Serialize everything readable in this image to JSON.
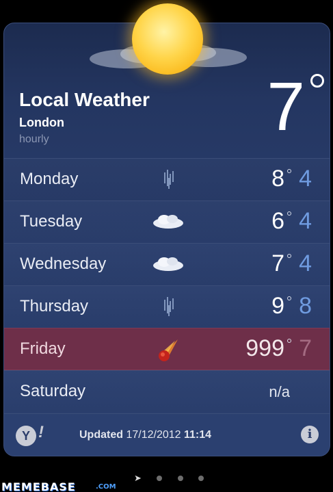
{
  "header": {
    "title": "Local Weather",
    "city": "London",
    "mode": "hourly",
    "current_temp": "7",
    "current_icon": "sun-with-clouds-icon"
  },
  "forecast": [
    {
      "day": "Monday",
      "icon": "rain-icon",
      "high": "8",
      "low": "4"
    },
    {
      "day": "Tuesday",
      "icon": "cloudy-icon",
      "high": "6",
      "low": "4"
    },
    {
      "day": "Wednesday",
      "icon": "cloudy-icon",
      "high": "7",
      "low": "4"
    },
    {
      "day": "Thursday",
      "icon": "rain-icon",
      "high": "9",
      "low": "8"
    },
    {
      "day": "Friday",
      "icon": "meteor-icon",
      "high": "999",
      "low": "7",
      "highlighted": true
    },
    {
      "day": "Saturday",
      "value": "n/a"
    }
  ],
  "footer": {
    "yahoo_logo": "Y",
    "yahoo_bang": "!",
    "updated_label": "Updated",
    "updated_date": "17/12/2012",
    "updated_time": "11:14",
    "info_symbol": "i"
  },
  "pager": {
    "current_page": 1,
    "page_count": 4
  },
  "watermark": {
    "name": "MEMEBASE",
    "domain": ".COM"
  },
  "colors": {
    "background": "#2a3e6d",
    "highlight_row": "#6e2f49",
    "low_temp": "#6f9be0",
    "sun": "#ffd54a"
  }
}
